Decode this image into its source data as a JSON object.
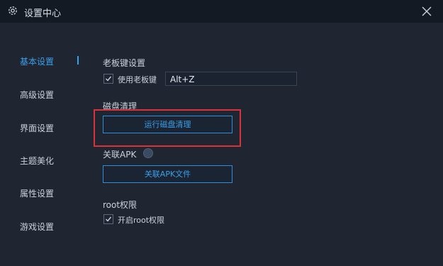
{
  "window": {
    "title": "设置中心"
  },
  "sidebar": {
    "items": [
      {
        "label": "基本设置",
        "active": true
      },
      {
        "label": "高级设置"
      },
      {
        "label": "界面设置"
      },
      {
        "label": "主题美化"
      },
      {
        "label": "属性设置"
      },
      {
        "label": "游戏设置"
      }
    ]
  },
  "boss_key": {
    "title": "老板键设置",
    "checkbox_label": "使用老板键",
    "checked": true,
    "hotkey_value": "Alt+Z"
  },
  "disk_cleanup": {
    "title": "磁盘清理",
    "button_label": "运行磁盘清理"
  },
  "apk": {
    "title": "关联APK",
    "button_label": "关联APK文件"
  },
  "root": {
    "title": "root权限",
    "checkbox_label": "开启root权限",
    "checked": true
  },
  "colors": {
    "accent": "#3b9fe8",
    "highlight": "#d9323a",
    "background": "#1f2632",
    "titlebar": "#131a24"
  }
}
